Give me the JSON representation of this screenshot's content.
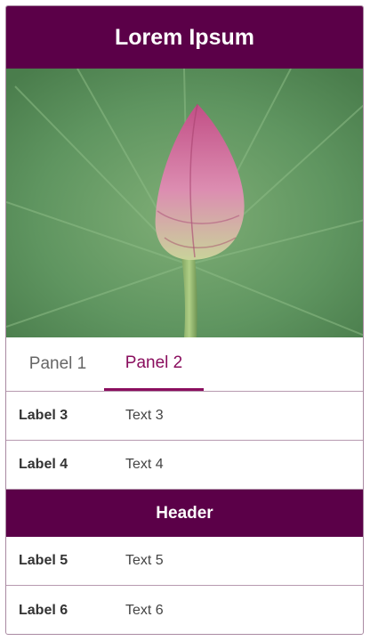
{
  "title": "Lorem Ipsum",
  "colors": {
    "primary": "#5b0048",
    "accent": "#8a0e5e"
  },
  "image": {
    "subject": "lotus-bud-image"
  },
  "tabs": [
    {
      "label": "Panel 1",
      "active": false
    },
    {
      "label": "Panel 2",
      "active": true
    }
  ],
  "rows_top": [
    {
      "label": "Label 3",
      "value": "Text 3"
    },
    {
      "label": "Label 4",
      "value": "Text 4"
    }
  ],
  "section": {
    "header": "Header"
  },
  "rows_bottom": [
    {
      "label": "Label 5",
      "value": "Text 5"
    },
    {
      "label": "Label 6",
      "value": "Text 6"
    }
  ]
}
